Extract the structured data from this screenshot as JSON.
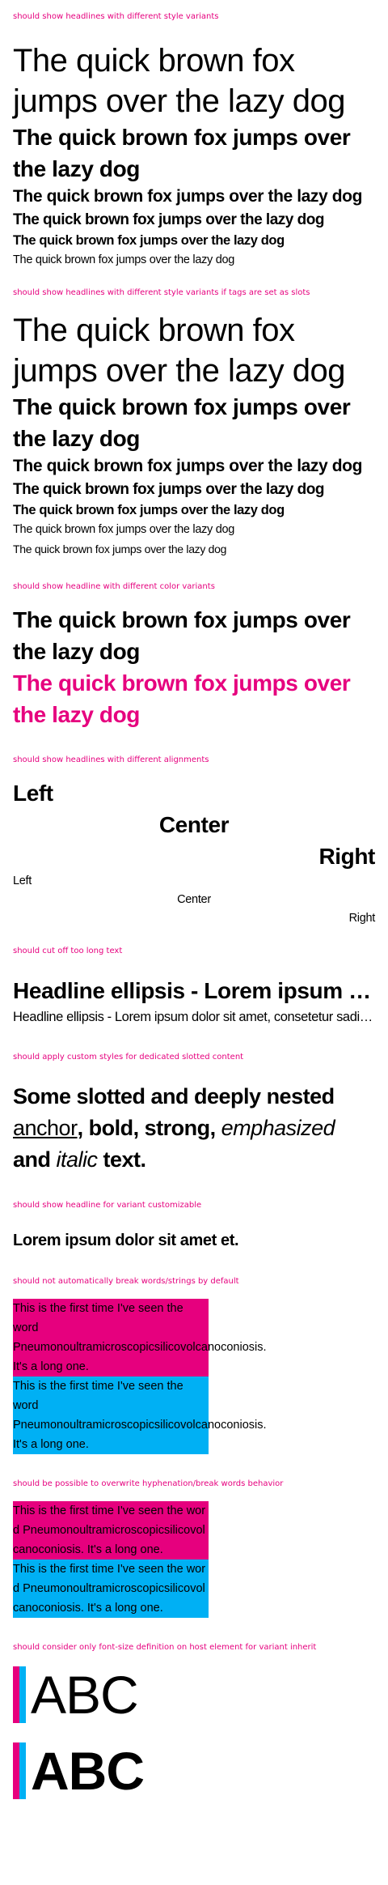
{
  "sections": {
    "style_variants": {
      "label": "should show headlines with different style variants",
      "lines": [
        "The quick brown fox jumps over the lazy dog",
        "The quick brown fox jumps over the lazy dog",
        "The quick brown fox jumps over the lazy dog",
        "The quick brown fox jumps over the lazy dog",
        "The quick brown fox jumps over the lazy dog",
        "The quick brown fox jumps over the lazy dog"
      ]
    },
    "slot_tags": {
      "label": "should show headlines with different style variants if tags are set as slots",
      "lines": [
        "The quick brown fox jumps over the lazy dog",
        "The quick brown fox jumps over the lazy dog",
        "The quick brown fox jumps over the lazy dog",
        "The quick brown fox jumps over the lazy dog",
        "The quick brown fox jumps over the lazy dog",
        "The quick brown fox jumps over the lazy dog",
        "The quick brown fox jumps over the lazy dog"
      ]
    },
    "color_variants": {
      "label": "should show headline with different color variants",
      "default_text": "The quick brown fox jumps over the lazy dog",
      "inherit_text": "The quick brown fox jumps over the lazy dog",
      "accent_color": "#e6007e"
    },
    "alignments": {
      "label": "should show headlines with different alignments",
      "large": [
        "Left",
        "Center",
        "Right"
      ],
      "small": [
        "Left",
        "Center",
        "Right"
      ]
    },
    "ellipsis": {
      "label": "should cut off too long text",
      "large": "Headline ellipsis - Lorem ipsum dolor sit amet, consetetur sadipscing elitr, sed diam nonumy eirmod tempor invidunt",
      "small": "Headline ellipsis - Lorem ipsum dolor sit amet, consetetur sadipscing elitr, sed diam nonumy eirmod tempor invidunt"
    },
    "custom_styles": {
      "label": "should apply custom styles for dedicated slotted content",
      "prefix": "Some slotted and deeply nested ",
      "anchor": "anchor",
      "sep1": ", ",
      "bold": "bold",
      "sep2": ", ",
      "strong": "strong",
      "sep3": ", ",
      "emphasized": "emphasized",
      "sep4": " and ",
      "italic": "italic",
      "suffix": " text."
    },
    "customizable": {
      "label": "should show headline for variant customizable",
      "text": "Lorem ipsum dolor sit amet et."
    },
    "no_break": {
      "label": "should not automatically break words/strings by default",
      "line1": "This is the first time I've seen the word",
      "word": "Pneumonoultramicroscopicsilicovolcanoconiosis.",
      "line3": "It's a long one."
    },
    "hyphenation": {
      "label": "should be possible to overwrite hyphenation/break words behavior",
      "text": "This is the first time I've seen the word Pneumonoultramicroscopicsilicovolcanoconiosis. It's a long one."
    },
    "inherit": {
      "label": "should consider only font-size definition on host element for variant inherit",
      "text1": "ABC",
      "text2": "ABC"
    }
  },
  "colors": {
    "accent": "#e6007e",
    "cyan": "#00b0f4"
  }
}
